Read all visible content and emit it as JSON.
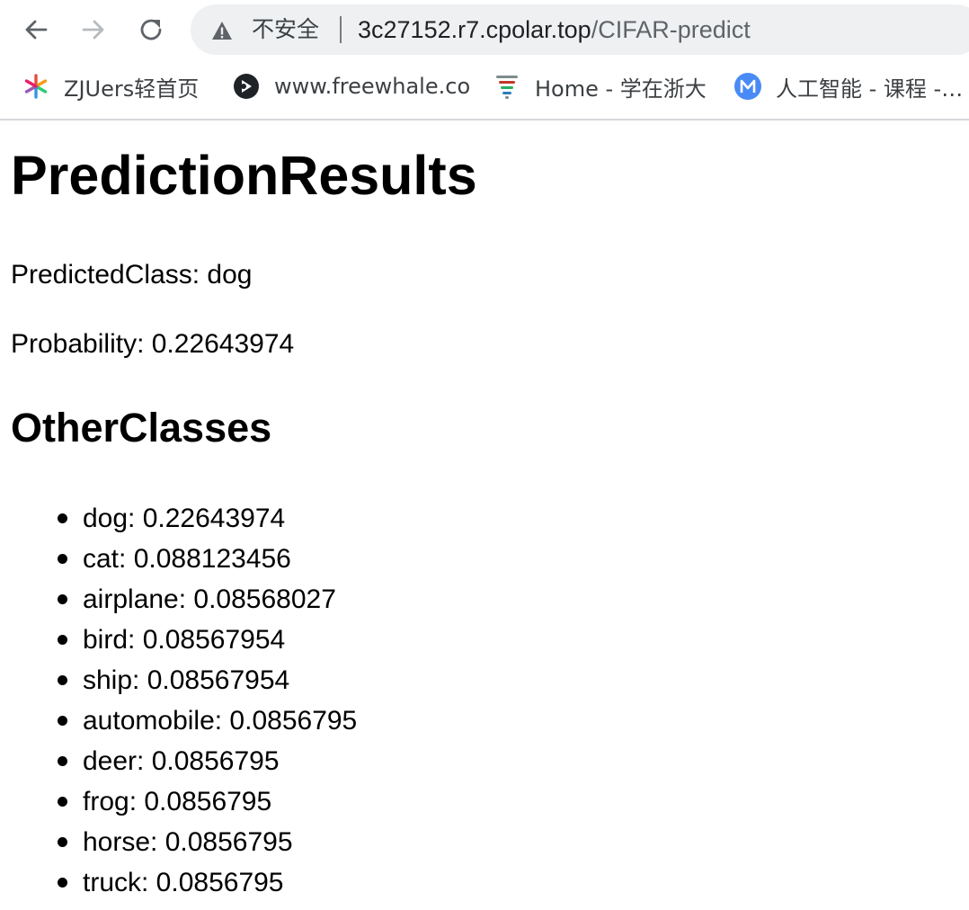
{
  "browser": {
    "security_label": "不安全",
    "url_host": "3c27152.r7.cpolar.top",
    "url_path": "/CIFAR-predict",
    "bookmarks": [
      {
        "label": "ZJUers轻首页",
        "icon": "pinwheel-icon"
      },
      {
        "label": "www.freewhale.co",
        "icon": "whale-icon"
      },
      {
        "label": "Home - 学在浙大",
        "icon": "stack-icon"
      },
      {
        "label": "人工智能 - 课程 -…",
        "icon": "m-logo-icon"
      }
    ]
  },
  "page": {
    "title": "PredictionResults",
    "predicted_class_text": "PredictedClass: dog",
    "probability_text": "Probability: 0.22643974",
    "other_classes_heading": "OtherClasses",
    "other_classes": [
      "dog: 0.22643974",
      "cat: 0.088123456",
      "airplane: 0.08568027",
      "bird: 0.08567954",
      "ship: 0.08567954",
      "automobile: 0.0856795",
      "deer: 0.0856795",
      "frog: 0.0856795",
      "horse: 0.0856795",
      "truck: 0.0856795"
    ]
  },
  "colors": {
    "omnibox_bg": "#eef0f2",
    "url_host": "#202124",
    "url_path": "#5f6368",
    "icon_gray": "#5f6368"
  }
}
